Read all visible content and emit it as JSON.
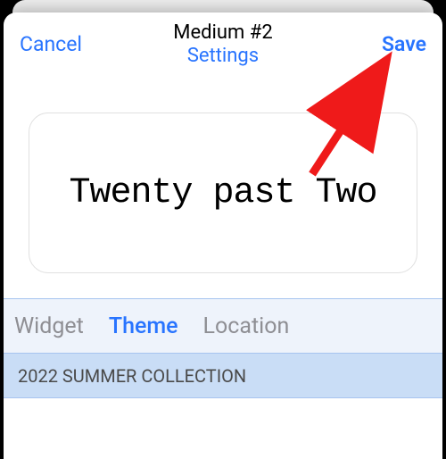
{
  "header": {
    "cancel": "Cancel",
    "title": "Medium #2",
    "subtitle": "Settings",
    "save": "Save"
  },
  "preview": {
    "text": "Twenty past Two"
  },
  "tabs": {
    "widget": "Widget",
    "theme": "Theme",
    "location": "Location"
  },
  "section": {
    "label": "2022 SUMMER COLLECTION"
  }
}
